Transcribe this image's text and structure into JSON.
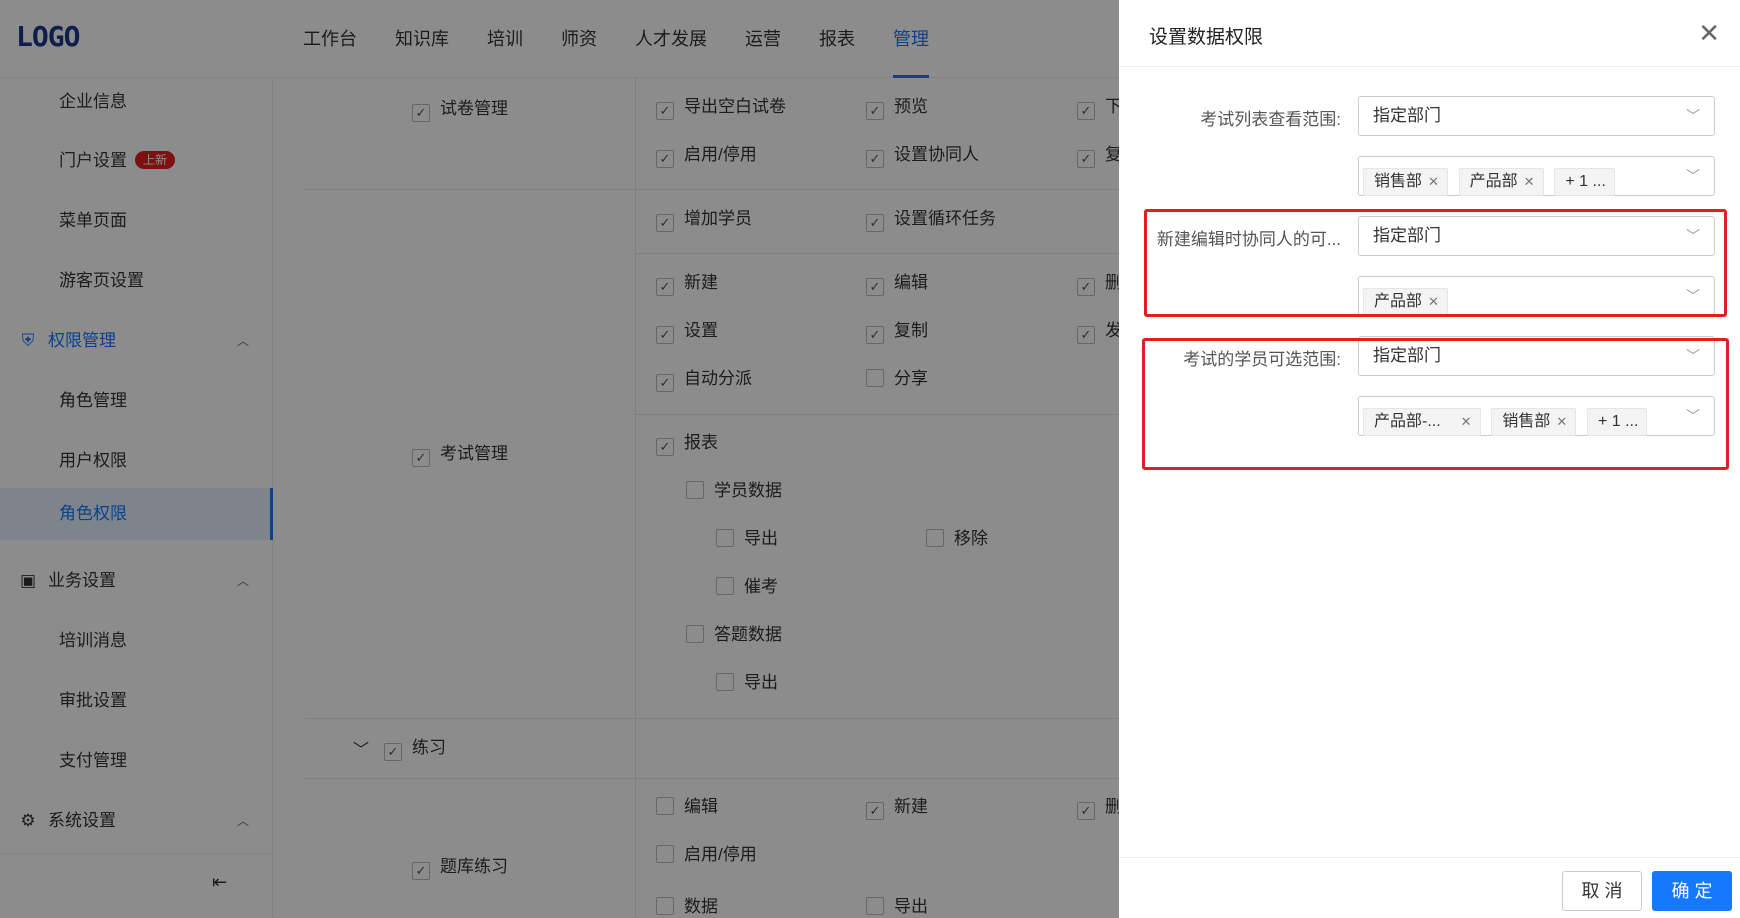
{
  "app": {
    "logo": "LOGO"
  },
  "nav": {
    "items": [
      "工作台",
      "知识库",
      "培训",
      "师资",
      "人才发展",
      "运营",
      "报表",
      "管理"
    ],
    "active_index": 7
  },
  "sidebar": {
    "items": [
      "企业信息",
      "门户设置",
      "菜单页面",
      "游客页设置",
      "权限管理",
      "角色管理",
      "用户权限",
      "角色权限",
      "业务设置",
      "培训消息",
      "审批设置",
      "支付管理",
      "系统设置"
    ],
    "badge": "上新",
    "active_item": "角色权限"
  },
  "permissions": {
    "groups": {
      "paper_mgmt": "试卷管理",
      "exam_mgmt": "考试管理",
      "practice": "练习",
      "bank_practice": "题库练习"
    },
    "items": {
      "export_blank": "导出空白试卷",
      "preview": "预览",
      "download": "下",
      "enable_disable": "启用/停用",
      "set_collab": "设置协同人",
      "copy_partial": "复",
      "add_student": "增加学员",
      "set_cycle_task": "设置循环任务",
      "new": "新建",
      "edit": "编辑",
      "delete_partial": "删",
      "settings": "设置",
      "copy": "复制",
      "publish_partial": "发",
      "auto_assign": "自动分派",
      "share": "分享",
      "report": "报表",
      "student_data": "学员数据",
      "export": "导出",
      "remove": "移除",
      "urge": "催考",
      "answer_data": "答题数据",
      "export2": "导出",
      "p_edit": "编辑",
      "p_new": "新建",
      "p_delete_partial": "删",
      "p_enable": "启用/停用",
      "p_data_partial": "数据",
      "p_export_partial": "导出"
    }
  },
  "drawer": {
    "title": "设置数据权限",
    "close_icon": "close-icon",
    "rows": [
      {
        "label": "考试列表查看范围:",
        "select_value": "指定部门",
        "tags": [
          "销售部",
          "产品部"
        ],
        "more": "+ 1 ..."
      },
      {
        "label": "新建编辑时协同人的可...",
        "select_value": "指定部门",
        "tags": [
          "产品部"
        ],
        "more": ""
      },
      {
        "label": "考试的学员可选范围:",
        "select_value": "指定部门",
        "tags": [
          "产品部-...",
          "销售部"
        ],
        "more": "+ 1 ..."
      }
    ],
    "cancel_label": "取 消",
    "ok_label": "确 定"
  },
  "colors": {
    "accent": "#1677ff",
    "highlight": "#e02020",
    "overlay": "rgba(0,0,0,0.45)"
  }
}
